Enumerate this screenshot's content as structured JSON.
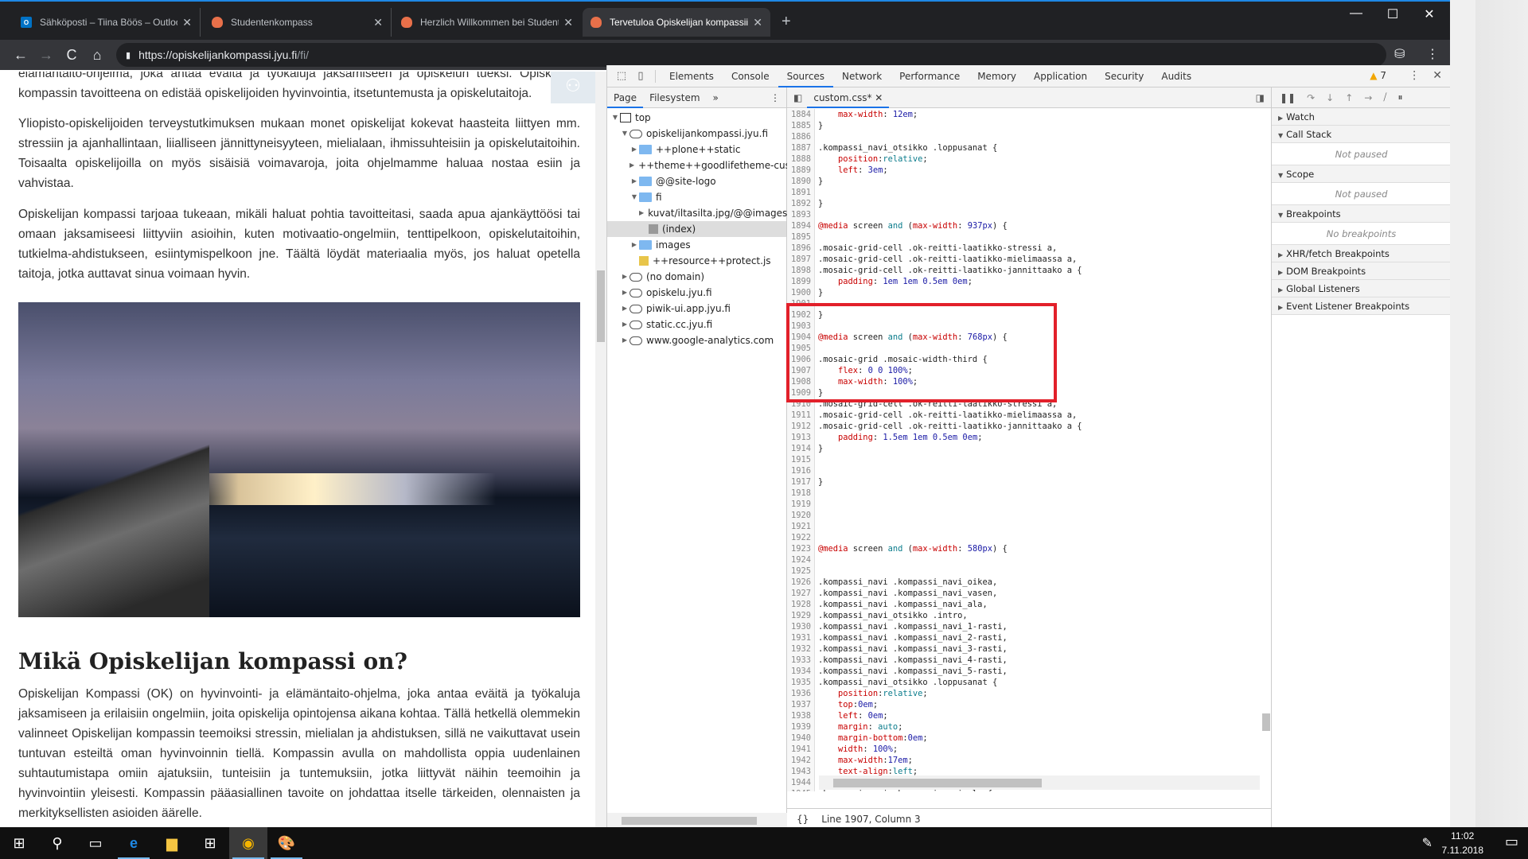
{
  "browser": {
    "tabs": [
      {
        "title": "Sähköposti – Tiina Böös – Outlook",
        "favicon": "outlook-icon"
      },
      {
        "title": "Studentenkompass",
        "favicon": "flame-icon"
      },
      {
        "title": "Herzlich Willkommen bei Studentenkompass",
        "favicon": "flame-icon"
      },
      {
        "title": "Tervetuloa Opiskelijan kompassiin",
        "favicon": "flame-icon",
        "active": true
      }
    ],
    "new_tab": "+",
    "window": {
      "minimize": "—",
      "maximize": "☐",
      "close": "✕"
    },
    "url_host": "https://opiskelijankompassi.jyu.fi",
    "url_path": "/fi/",
    "icons": {
      "back": "←",
      "forward": "→",
      "reload": "C",
      "home": "⌂",
      "lock": "🔒",
      "incognito": "🕶",
      "menu": "⋮"
    }
  },
  "page": {
    "para1": "elämäntaito-ohjelma, joka antaa eväitä ja työkaluja jaksamiseen ja opiskelun tueksi. Opiskelijan kompassin tavoitteena on edistää opiskelijoiden hyvinvointia, itsetuntemusta ja opiskelutaitoja.",
    "para2": "Yliopisto-opiskelijoiden terveystutkimuksen mukaan monet opiskelijat kokevat haasteita liittyen mm. stressiin ja ajanhallintaan, liialliseen jännittyneisyyteen, mielialaan, ihmissuhteisiin ja opiskelutaitoihin. Toisaalta opiskelijoilla on myös sisäisiä voimavaroja, joita ohjelmamme haluaa nostaa esiin ja vahvistaa.",
    "para3": "Opiskelijan kompassi tarjoaa tukeaan, mikäli haluat pohtia tavoitteitasi, saada apua ajankäyttöösi tai omaan jaksamiseesi liittyviin asioihin, kuten motivaatio-ongelmiin, tenttipelkoon, opiskelutaitoihin, tutkielma-ahdistukseen, esiintymispelkoon jne. Täältä löydät materiaalia myös, jos haluat opetella taitoja, jotka auttavat sinua voimaan hyvin.",
    "heading": "Mikä Opiskelijan kompassi on?",
    "para4": "Opiskelijan Kompassi (OK) on hyvinvointi- ja elämäntaito-ohjelma, joka antaa eväitä ja työkaluja jaksamiseen ja erilaisiin ongelmiin, joita opiskelija opintojensa aikana kohtaa. Tällä hetkellä olemmekin valinneet Opiskelijan kompassin teemoiksi stressin, mielialan ja ahdistuksen, sillä ne vaikuttavat usein tuntuvan esteiltä oman hyvinvoinnin tiellä. Kompassin avulla on mahdollista oppia uudenlainen suhtautumistapa omiin ajatuksiin, tunteisiin ja tuntemuksiin, jotka liittyvät näihin teemoihin ja hyvinvointiin yleisesti. Kompassin pääasiallinen tavoite on johdattaa itselle tärkeiden, olennaisten ja merkityksellisten asioiden äärelle.",
    "photo_alt": "Evening bridge over lake with lit university buildings"
  },
  "devtools": {
    "tabs": [
      "Elements",
      "Console",
      "Sources",
      "Network",
      "Performance",
      "Memory",
      "Application",
      "Security",
      "Audits"
    ],
    "active_tab": "Sources",
    "warnings": "7",
    "nav_tabs": [
      "Page",
      "Filesystem"
    ],
    "tree": [
      {
        "label": "top",
        "depth": 0,
        "icon": "frame",
        "arrow": "▼"
      },
      {
        "label": "opiskelijankompassi.jyu.fi",
        "depth": 1,
        "icon": "cloud",
        "arrow": "▼"
      },
      {
        "label": "++plone++static",
        "depth": 2,
        "icon": "folder",
        "arrow": "▶"
      },
      {
        "label": "++theme++goodlifetheme-custom",
        "depth": 2,
        "icon": "folder",
        "arrow": "▶"
      },
      {
        "label": "@@site-logo",
        "depth": 2,
        "icon": "folder",
        "arrow": "▶"
      },
      {
        "label": "fi",
        "depth": 2,
        "icon": "folder",
        "arrow": "▼"
      },
      {
        "label": "kuvat/iltasilta.jpg/@@images",
        "depth": 3,
        "icon": "folder",
        "arrow": "▶"
      },
      {
        "label": "(index)",
        "depth": 3,
        "icon": "file",
        "arrow": "",
        "selected": true
      },
      {
        "label": "images",
        "depth": 2,
        "icon": "folder",
        "arrow": "▶"
      },
      {
        "label": "++resource++protect.js",
        "depth": 2,
        "icon": "js",
        "arrow": ""
      },
      {
        "label": "(no domain)",
        "depth": 1,
        "icon": "cloud",
        "arrow": "▶"
      },
      {
        "label": "opiskelu.jyu.fi",
        "depth": 1,
        "icon": "cloud",
        "arrow": "▶"
      },
      {
        "label": "piwik-ui.app.jyu.fi",
        "depth": 1,
        "icon": "cloud",
        "arrow": "▶"
      },
      {
        "label": "static.cc.jyu.fi",
        "depth": 1,
        "icon": "cloud",
        "arrow": "▶"
      },
      {
        "label": "www.google-analytics.com",
        "depth": 1,
        "icon": "cloud",
        "arrow": "▶"
      }
    ],
    "file_tab": "custom.css*",
    "code": [
      {
        "n": "1884",
        "t": [
          [
            "    ",
            ""
          ],
          [
            "max-width",
            "prop"
          ],
          [
            ": ",
            ""
          ],
          [
            "12em",
            "val"
          ],
          [
            ";",
            ""
          ]
        ]
      },
      {
        "n": "1885",
        "t": [
          [
            "}",
            ""
          ]
        ]
      },
      {
        "n": "1886",
        "t": []
      },
      {
        "n": "1887",
        "t": [
          [
            ".kompassi_navi_otsikko .loppusanat {",
            ""
          ]
        ]
      },
      {
        "n": "1888",
        "t": [
          [
            "    ",
            ""
          ],
          [
            "position",
            "prop"
          ],
          [
            ":",
            ""
          ],
          [
            "relative",
            "kw"
          ],
          [
            ";",
            ""
          ]
        ]
      },
      {
        "n": "1889",
        "t": [
          [
            "    ",
            ""
          ],
          [
            "left",
            "prop"
          ],
          [
            ": ",
            ""
          ],
          [
            "3em",
            "val"
          ],
          [
            ";",
            ""
          ]
        ]
      },
      {
        "n": "1890",
        "t": [
          [
            "}",
            ""
          ]
        ]
      },
      {
        "n": "1891",
        "t": []
      },
      {
        "n": "1892",
        "t": [
          [
            "}",
            ""
          ]
        ]
      },
      {
        "n": "1893",
        "t": []
      },
      {
        "n": "1894",
        "t": [
          [
            "@media",
            "at"
          ],
          [
            " screen ",
            ""
          ],
          [
            "and",
            "kw"
          ],
          [
            " (",
            ""
          ],
          [
            "max-width",
            "prop"
          ],
          [
            ": ",
            ""
          ],
          [
            "937px",
            "val"
          ],
          [
            ") {",
            ""
          ]
        ]
      },
      {
        "n": "1895",
        "t": []
      },
      {
        "n": "1896",
        "t": [
          [
            ".mosaic-grid-cell .ok-reitti-laatikko-stressi a,",
            ""
          ]
        ]
      },
      {
        "n": "1897",
        "t": [
          [
            ".mosaic-grid-cell .ok-reitti-laatikko-mielimaassa a,",
            ""
          ]
        ]
      },
      {
        "n": "1898",
        "t": [
          [
            ".mosaic-grid-cell .ok-reitti-laatikko-jannittaako a {",
            ""
          ]
        ]
      },
      {
        "n": "1899",
        "t": [
          [
            "    ",
            ""
          ],
          [
            "padding",
            "prop"
          ],
          [
            ": ",
            ""
          ],
          [
            "1em 1em 0.5em 0em",
            "val"
          ],
          [
            ";",
            ""
          ]
        ]
      },
      {
        "n": "1900",
        "t": [
          [
            "}",
            ""
          ]
        ]
      },
      {
        "n": "1901",
        "t": []
      },
      {
        "n": "1902",
        "t": [
          [
            "}",
            ""
          ]
        ]
      },
      {
        "n": "1903",
        "t": []
      },
      {
        "n": "1904",
        "t": [
          [
            "@media",
            "at"
          ],
          [
            " screen ",
            ""
          ],
          [
            "and",
            "kw"
          ],
          [
            " (",
            ""
          ],
          [
            "max-width",
            "prop"
          ],
          [
            ": ",
            ""
          ],
          [
            "768px",
            "val"
          ],
          [
            ") {",
            ""
          ]
        ]
      },
      {
        "n": "1905",
        "t": []
      },
      {
        "n": "1906",
        "t": [
          [
            ".mosaic-grid .mosaic-width-third {",
            ""
          ]
        ]
      },
      {
        "n": "1907",
        "t": [
          [
            "    ",
            ""
          ],
          [
            "flex",
            "prop"
          ],
          [
            ": ",
            ""
          ],
          [
            "0 0 100%",
            "val"
          ],
          [
            ";",
            ""
          ]
        ]
      },
      {
        "n": "1908",
        "t": [
          [
            "    ",
            ""
          ],
          [
            "max-width",
            "prop"
          ],
          [
            ": ",
            ""
          ],
          [
            "100%",
            "val"
          ],
          [
            ";",
            ""
          ]
        ]
      },
      {
        "n": "1909",
        "t": [
          [
            "}",
            ""
          ]
        ]
      },
      {
        "n": "1910",
        "t": [
          [
            ".mosaic-grid-cell .ok-reitti-laatikko-stressi a,",
            ""
          ]
        ]
      },
      {
        "n": "1911",
        "t": [
          [
            ".mosaic-grid-cell .ok-reitti-laatikko-mielimaassa a,",
            ""
          ]
        ]
      },
      {
        "n": "1912",
        "t": [
          [
            ".mosaic-grid-cell .ok-reitti-laatikko-jannittaako a {",
            ""
          ]
        ]
      },
      {
        "n": "1913",
        "t": [
          [
            "    ",
            ""
          ],
          [
            "padding",
            "prop"
          ],
          [
            ": ",
            ""
          ],
          [
            "1.5em 1em 0.5em 0em",
            "val"
          ],
          [
            ";",
            ""
          ]
        ]
      },
      {
        "n": "1914",
        "t": [
          [
            "}",
            ""
          ]
        ]
      },
      {
        "n": "1915",
        "t": []
      },
      {
        "n": "1916",
        "t": []
      },
      {
        "n": "1917",
        "t": [
          [
            "}",
            ""
          ]
        ]
      },
      {
        "n": "1918",
        "t": []
      },
      {
        "n": "1919",
        "t": []
      },
      {
        "n": "1920",
        "t": []
      },
      {
        "n": "1921",
        "t": []
      },
      {
        "n": "1922",
        "t": []
      },
      {
        "n": "1923",
        "t": [
          [
            "@media",
            "at"
          ],
          [
            " screen ",
            ""
          ],
          [
            "and",
            "kw"
          ],
          [
            " (",
            ""
          ],
          [
            "max-width",
            "prop"
          ],
          [
            ": ",
            ""
          ],
          [
            "580px",
            "val"
          ],
          [
            ") {",
            ""
          ]
        ]
      },
      {
        "n": "1924",
        "t": []
      },
      {
        "n": "1925",
        "t": []
      },
      {
        "n": "1926",
        "t": [
          [
            ".kompassi_navi .kompassi_navi_oikea,",
            ""
          ]
        ]
      },
      {
        "n": "1927",
        "t": [
          [
            ".kompassi_navi .kompassi_navi_vasen,",
            ""
          ]
        ]
      },
      {
        "n": "1928",
        "t": [
          [
            ".kompassi_navi .kompassi_navi_ala,",
            ""
          ]
        ]
      },
      {
        "n": "1929",
        "t": [
          [
            ".kompassi_navi_otsikko .intro,",
            ""
          ]
        ]
      },
      {
        "n": "1930",
        "t": [
          [
            ".kompassi_navi .kompassi_navi_1-rasti,",
            ""
          ]
        ]
      },
      {
        "n": "1931",
        "t": [
          [
            ".kompassi_navi .kompassi_navi_2-rasti,",
            ""
          ]
        ]
      },
      {
        "n": "1932",
        "t": [
          [
            ".kompassi_navi .kompassi_navi_3-rasti,",
            ""
          ]
        ]
      },
      {
        "n": "1933",
        "t": [
          [
            ".kompassi_navi .kompassi_navi_4-rasti,",
            ""
          ]
        ]
      },
      {
        "n": "1934",
        "t": [
          [
            ".kompassi_navi .kompassi_navi_5-rasti,",
            ""
          ]
        ]
      },
      {
        "n": "1935",
        "t": [
          [
            ".kompassi_navi_otsikko .loppusanat {",
            ""
          ]
        ]
      },
      {
        "n": "1936",
        "t": [
          [
            "    ",
            ""
          ],
          [
            "position",
            "prop"
          ],
          [
            ":",
            ""
          ],
          [
            "relative",
            "kw"
          ],
          [
            ";",
            ""
          ]
        ]
      },
      {
        "n": "1937",
        "t": [
          [
            "    ",
            ""
          ],
          [
            "top",
            "prop"
          ],
          [
            ":",
            ""
          ],
          [
            "0em",
            "val"
          ],
          [
            ";",
            ""
          ]
        ]
      },
      {
        "n": "1938",
        "t": [
          [
            "    ",
            ""
          ],
          [
            "left",
            "prop"
          ],
          [
            ": ",
            ""
          ],
          [
            "0em",
            "val"
          ],
          [
            ";",
            ""
          ]
        ]
      },
      {
        "n": "1939",
        "t": [
          [
            "    ",
            ""
          ],
          [
            "margin",
            "prop"
          ],
          [
            ": ",
            ""
          ],
          [
            "auto",
            "kw"
          ],
          [
            ";",
            ""
          ]
        ]
      },
      {
        "n": "1940",
        "t": [
          [
            "    ",
            ""
          ],
          [
            "margin-bottom",
            "prop"
          ],
          [
            ":",
            ""
          ],
          [
            "0em",
            "val"
          ],
          [
            ";",
            ""
          ]
        ]
      },
      {
        "n": "1941",
        "t": [
          [
            "    ",
            ""
          ],
          [
            "width",
            "prop"
          ],
          [
            ": ",
            ""
          ],
          [
            "100%",
            "val"
          ],
          [
            ";",
            ""
          ]
        ]
      },
      {
        "n": "1942",
        "t": [
          [
            "    ",
            ""
          ],
          [
            "max-width",
            "prop"
          ],
          [
            ":",
            ""
          ],
          [
            "17em",
            "val"
          ],
          [
            ";",
            ""
          ]
        ]
      },
      {
        "n": "1943",
        "t": [
          [
            "    ",
            ""
          ],
          [
            "text-align",
            "prop"
          ],
          [
            ":",
            ""
          ],
          [
            "left",
            "kw"
          ],
          [
            ";",
            ""
          ]
        ]
      },
      {
        "n": "1944",
        "t": [
          [
            "}",
            ""
          ]
        ]
      },
      {
        "n": "1945",
        "t": [
          [
            ".kompassi_navi .kompassi_navi_yla {",
            ""
          ]
        ]
      },
      {
        "n": "1946",
        "t": []
      }
    ],
    "status": "Line 1907, Column 3",
    "debugger": {
      "sections": [
        {
          "label": "Watch",
          "open": false
        },
        {
          "label": "Call Stack",
          "open": true,
          "body": "Not paused"
        },
        {
          "label": "Scope",
          "open": true,
          "body": "Not paused"
        },
        {
          "label": "Breakpoints",
          "open": true,
          "body": "No breakpoints"
        },
        {
          "label": "XHR/fetch Breakpoints",
          "open": false
        },
        {
          "label": "DOM Breakpoints",
          "open": false
        },
        {
          "label": "Global Listeners",
          "open": false
        },
        {
          "label": "Event Listener Breakpoints",
          "open": false
        }
      ]
    }
  },
  "taskbar": {
    "time": "11:02",
    "date": "7.11.2018"
  }
}
